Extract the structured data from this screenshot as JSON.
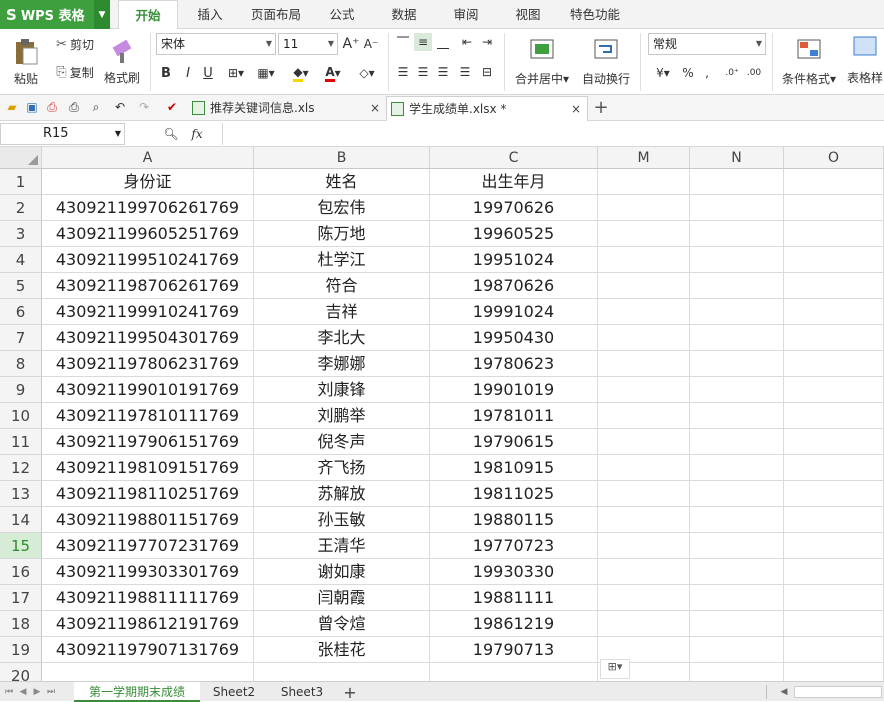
{
  "app": {
    "name": "WPS 表格",
    "logo": "S"
  },
  "menu_tabs": [
    "开始",
    "插入",
    "页面布局",
    "公式",
    "数据",
    "审阅",
    "视图",
    "特色功能"
  ],
  "active_menu": "开始",
  "ribbon": {
    "paste": "粘贴",
    "cut": "剪切",
    "copy": "复制",
    "format_painter": "格式刷",
    "font_name": "宋体",
    "font_size": "11",
    "bold": "B",
    "italic": "I",
    "underline": "U",
    "merge_center": "合并居中",
    "wrap_text": "自动换行",
    "number_format": "常规",
    "conditional_format": "条件格式",
    "table_style": "表格样"
  },
  "file_tabs": [
    {
      "name": "推荐关键词信息.xls",
      "active": false
    },
    {
      "name": "学生成绩单.xlsx *",
      "active": true
    }
  ],
  "formula_bar": {
    "name_box": "R15",
    "fx": "fx",
    "content": ""
  },
  "columns": [
    "A",
    "B",
    "C",
    "M",
    "N",
    "O"
  ],
  "selected_row": 15,
  "rows": [
    {
      "n": "1",
      "a": "身份证",
      "b": "姓名",
      "c": "出生年月"
    },
    {
      "n": "2",
      "a": "430921199706261769",
      "b": "包宏伟",
      "c": "19970626"
    },
    {
      "n": "3",
      "a": "430921199605251769",
      "b": "陈万地",
      "c": "19960525"
    },
    {
      "n": "4",
      "a": "430921199510241769",
      "b": "杜学江",
      "c": "19951024"
    },
    {
      "n": "5",
      "a": "430921198706261769",
      "b": "符合",
      "c": "19870626"
    },
    {
      "n": "6",
      "a": "430921199910241769",
      "b": "吉祥",
      "c": "19991024"
    },
    {
      "n": "7",
      "a": "430921199504301769",
      "b": "李北大",
      "c": "19950430"
    },
    {
      "n": "8",
      "a": "430921197806231769",
      "b": "李娜娜",
      "c": "19780623"
    },
    {
      "n": "9",
      "a": "430921199010191769",
      "b": "刘康锋",
      "c": "19901019"
    },
    {
      "n": "10",
      "a": "430921197810111769",
      "b": "刘鹏举",
      "c": "19781011"
    },
    {
      "n": "11",
      "a": "430921197906151769",
      "b": "倪冬声",
      "c": "19790615"
    },
    {
      "n": "12",
      "a": "430921198109151769",
      "b": "齐飞扬",
      "c": "19810915"
    },
    {
      "n": "13",
      "a": "430921198110251769",
      "b": "苏解放",
      "c": "19811025"
    },
    {
      "n": "14",
      "a": "430921198801151769",
      "b": "孙玉敏",
      "c": "19880115"
    },
    {
      "n": "15",
      "a": "430921197707231769",
      "b": "王清华",
      "c": "19770723"
    },
    {
      "n": "16",
      "a": "430921199303301769",
      "b": "谢如康",
      "c": "19930330"
    },
    {
      "n": "17",
      "a": "430921198811111769",
      "b": "闫朝霞",
      "c": "19881111"
    },
    {
      "n": "18",
      "a": "430921198612191769",
      "b": "曾令煊",
      "c": "19861219"
    },
    {
      "n": "19",
      "a": "430921197907131769",
      "b": "张桂花",
      "c": "19790713"
    },
    {
      "n": "20",
      "a": "",
      "b": "",
      "c": ""
    }
  ],
  "sheets": [
    {
      "name": "第一学期期末成绩",
      "active": true
    },
    {
      "name": "Sheet2",
      "active": false
    },
    {
      "name": "Sheet3",
      "active": false
    }
  ],
  "colors": {
    "accent": "#3d9f3d",
    "selected_row_header": "#d7ecd7"
  }
}
